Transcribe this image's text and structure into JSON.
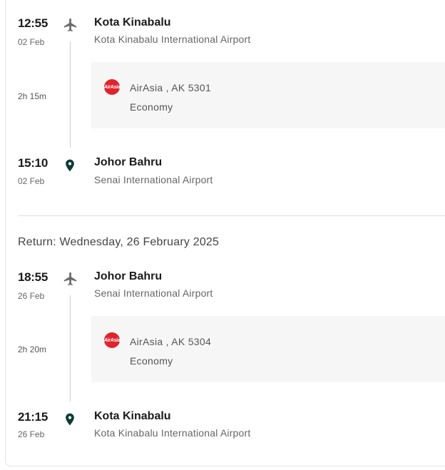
{
  "outbound": {
    "depart": {
      "time": "12:55",
      "date": "02 Feb",
      "city": "Kota Kinabalu",
      "airport": "Kota Kinabalu International Airport"
    },
    "duration": "2h 15m",
    "flight": {
      "logo_text": "AirAsia",
      "airline": "AirAsia , AK 5301",
      "cabin": "Economy"
    },
    "arrive": {
      "time": "15:10",
      "date": "02 Feb",
      "city": "Johor Bahru",
      "airport": "Senai International Airport"
    }
  },
  "return": {
    "title": "Return: Wednesday, 26 February 2025",
    "depart": {
      "time": "18:55",
      "date": "26 Feb",
      "city": "Johor Bahru",
      "airport": "Senai International Airport"
    },
    "duration": "2h 20m",
    "flight": {
      "logo_text": "AirAsia",
      "airline": "AirAsia , AK 5304",
      "cabin": "Economy"
    },
    "arrive": {
      "time": "21:15",
      "date": "26 Feb",
      "city": "Kota Kinabalu",
      "airport": "Kota Kinabalu International Airport"
    }
  },
  "icons": {
    "departure": "airplane-icon",
    "arrival": "map-pin-icon"
  },
  "colors": {
    "airasia_red": "#e0232d",
    "pin": "#0f3b36",
    "plane": "#6b6b6b"
  }
}
